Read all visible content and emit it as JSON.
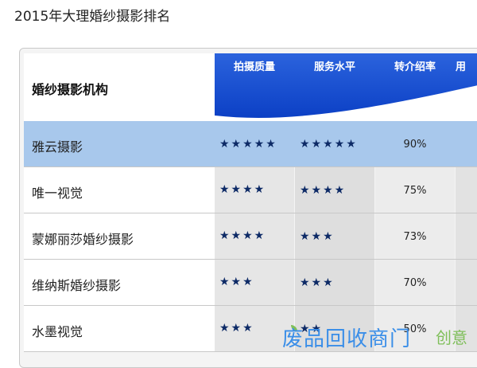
{
  "page_title": "2015年大理婚纱摄影排名",
  "table": {
    "header": {
      "name_col": "婚纱摄影机构",
      "columns": [
        "拍摄质量",
        "服务水平",
        "转介绍率",
        "用"
      ]
    },
    "rows": [
      {
        "name": "雅云摄影",
        "quality_stars": 5,
        "service_stars": 5,
        "referral": "90%",
        "selected": true
      },
      {
        "name": "唯一视觉",
        "quality_stars": 4,
        "service_stars": 4,
        "referral": "75%",
        "selected": false
      },
      {
        "name": "蒙娜丽莎婚纱摄影",
        "quality_stars": 4,
        "service_stars": 3,
        "referral": "73%",
        "selected": false
      },
      {
        "name": "维纳斯婚纱摄影",
        "quality_stars": 3,
        "service_stars": 3,
        "referral": "70%",
        "selected": false
      },
      {
        "name": "水墨视觉",
        "quality_stars": 3,
        "service_stars": 2,
        "referral": "50%",
        "selected": false
      }
    ]
  },
  "watermark": {
    "text": "废品回收商门",
    "text2": "创意"
  },
  "colors": {
    "header_blue": "#0a3ec4",
    "selected_row": "#a8c8ec",
    "star": "#0d2a66"
  }
}
